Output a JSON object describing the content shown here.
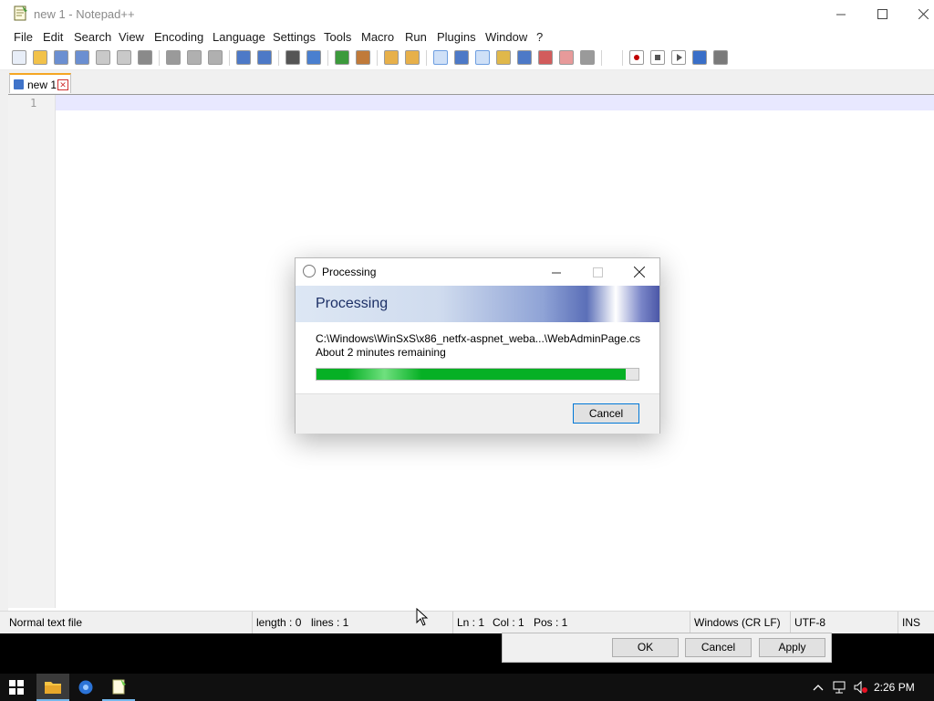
{
  "window": {
    "title": "new 1 - Notepad++"
  },
  "menu": [
    "File",
    "Edit",
    "Search",
    "View",
    "Encoding",
    "Language",
    "Settings",
    "Tools",
    "Macro",
    "Run",
    "Plugins",
    "Window",
    "?"
  ],
  "toolbar": {
    "icons": [
      "new-file-icon",
      "open-file-icon",
      "save-icon",
      "save-all-icon",
      "close-icon",
      "close-all-icon",
      "print-icon",
      "cut-icon",
      "copy-icon",
      "paste-icon",
      "undo-icon",
      "redo-icon",
      "find-icon",
      "replace-icon",
      "zoom-in-icon",
      "zoom-out-icon",
      "sync-vertical-icon",
      "sync-horizontal-icon",
      "word-wrap-icon",
      "show-all-chars-icon",
      "indent-guide-icon",
      "doc-map-icon",
      "function-list-icon",
      "folder-as-workspace-icon",
      "doc-switcher-icon",
      "monitoring-icon",
      "record-macro-icon",
      "stop-macro-icon",
      "play-macro-icon",
      "run-macro-multiple-icon",
      "save-macro-icon"
    ]
  },
  "tab": {
    "label": "new 1"
  },
  "editor": {
    "line_number": "1"
  },
  "status_bar": {
    "file_type": "Normal text file",
    "length": "length : 0",
    "lines": "lines : 1",
    "ln": "Ln : 1",
    "col": "Col : 1",
    "pos": "Pos : 1",
    "eol": "Windows (CR LF)",
    "encoding": "UTF-8",
    "mode": "INS"
  },
  "processing_dialog": {
    "title": "Processing",
    "heading": "Processing",
    "path": "C:\\Windows\\WinSxS\\x86_netfx-aspnet_weba...\\WebAdminPage.cs",
    "time_remaining": "About 2 minutes remaining",
    "progress_percent": 96,
    "cancel_label": "Cancel"
  },
  "background_dialog": {
    "ok_label": "OK",
    "cancel_label": "Cancel",
    "apply_label": "Apply"
  },
  "taskbar": {
    "clock": "2:26 PM"
  },
  "colors": {
    "progress": "#06b025",
    "accent": "#0078d7",
    "tab_accent": "#f5a623"
  }
}
